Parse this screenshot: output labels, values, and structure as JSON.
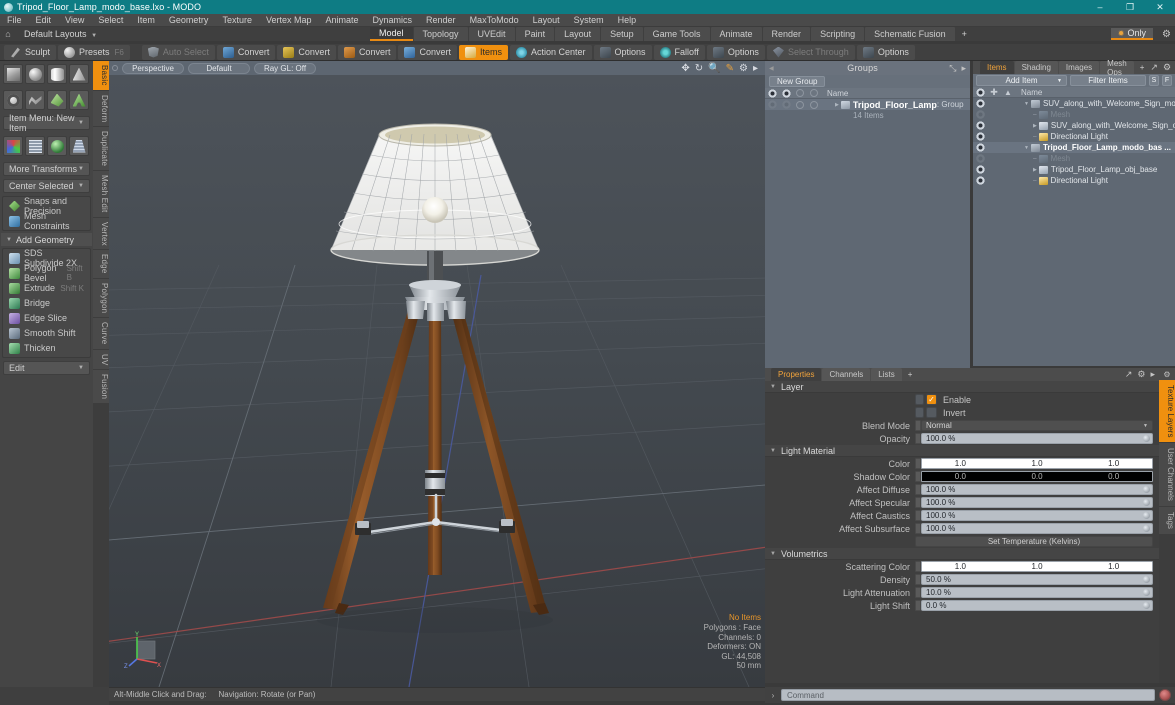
{
  "titlebar": {
    "title": "Tripod_Floor_Lamp_modo_base.lxo - MODO",
    "minimize": "–",
    "maximize": "❐",
    "close": "✕"
  },
  "menubar": {
    "items": [
      "File",
      "Edit",
      "View",
      "Select",
      "Item",
      "Geometry",
      "Texture",
      "Vertex Map",
      "Animate",
      "Dynamics",
      "Render",
      "MaxToModo",
      "Layout",
      "System",
      "Help"
    ]
  },
  "layoutrow": {
    "home_icon": "⌂",
    "layout_label": "Default Layouts",
    "caret": "▼",
    "only_label": "Only",
    "only_star": "✹",
    "gear": "⚙"
  },
  "layout_tabs": {
    "items": [
      "Model",
      "Topology",
      "UVEdit",
      "Paint",
      "Layout",
      "Setup",
      "Game Tools",
      "Animate",
      "Render",
      "Scripting",
      "Schematic Fusion"
    ],
    "active": "Model",
    "plus": "+"
  },
  "toolbar": {
    "buttons": [
      {
        "label": "Sculpt",
        "icon": "sculpt-icon",
        "state": "normal"
      },
      {
        "label": "Presets",
        "icon": "presets-icon",
        "state": "normal",
        "shortcut": "F6"
      },
      {
        "label": "Auto Select",
        "icon": "auto-select-icon",
        "state": "dim"
      },
      {
        "label": "Convert",
        "icon": "convert-blue-icon",
        "state": "normal"
      },
      {
        "label": "Convert",
        "icon": "convert-yellow-icon",
        "state": "normal"
      },
      {
        "label": "Convert",
        "icon": "convert-orange-icon",
        "state": "normal"
      },
      {
        "label": "Convert",
        "icon": "convert-cyan-icon",
        "state": "normal"
      },
      {
        "label": "Items",
        "icon": "items-icon",
        "state": "active"
      },
      {
        "label": "Action Center",
        "icon": "action-center-icon",
        "state": "normal"
      },
      {
        "label": "Options",
        "icon": "options-icon",
        "state": "normal"
      },
      {
        "label": "Falloff",
        "icon": "falloff-icon",
        "state": "normal"
      },
      {
        "label": "Options",
        "icon": "options-icon",
        "state": "normal"
      },
      {
        "label": "Select Through",
        "icon": "select-through-icon",
        "state": "dim"
      },
      {
        "label": "Options",
        "icon": "options-icon",
        "state": "normal"
      }
    ]
  },
  "left_panel": {
    "primitives_row1": [
      "cube-shape-icon",
      "sphere-shape-icon",
      "cylinder-shape-icon",
      "cone-shape-icon"
    ],
    "primitives_row2": [
      "torus-shape-icon",
      "curve-shape-icon",
      "polygon-shape-icon",
      "text-shape-icon"
    ],
    "item_menu": "Item Menu: New Item",
    "tools_row": [
      "transform-axis-icon",
      "grid-mesh-icon",
      "gem-icon",
      "pillar-icon"
    ],
    "more_transforms": "More Transforms",
    "center_selected": "Center Selected",
    "snaps": "Snaps and Precision",
    "mesh_constraints": "Mesh Constraints",
    "add_geometry": "Add Geometry",
    "geometry_tools": [
      {
        "label": "SDS Subdivide 2X",
        "shortcut": ""
      },
      {
        "label": "Polygon Bevel",
        "shortcut": "Shift B"
      },
      {
        "label": "Extrude",
        "shortcut": "Shift K"
      },
      {
        "label": "Bridge",
        "shortcut": ""
      },
      {
        "label": "Edge Slice",
        "shortcut": ""
      },
      {
        "label": "Smooth Shift",
        "shortcut": ""
      },
      {
        "label": "Thicken",
        "shortcut": ""
      }
    ],
    "edit_dropdown": "Edit",
    "vertical_tabs": [
      "Basic",
      "Deform",
      "Duplicate",
      "Mesh Edit",
      "Vertex",
      "Edge",
      "Polygon",
      "Curve",
      "UV",
      "Fusion"
    ],
    "vertical_active": "Basic"
  },
  "viewport": {
    "view_mode": "Perspective",
    "shading": "Default",
    "raygl": "Ray GL: Off",
    "tool_icons": [
      "move-icon",
      "rotate-icon",
      "zoom-icon",
      "paint-icon",
      "gear-icon",
      "arrow-icon"
    ],
    "stats": {
      "selection": "No Items",
      "polygons": "Polygons : Face",
      "channels": "Channels: 0",
      "deformers": "Deformers: ON",
      "gl": "GL: 44,508",
      "scale": "50 mm"
    },
    "axis_labels": {
      "x": "X",
      "y": "Y",
      "z": "Z"
    }
  },
  "statusbar": {
    "hint_key": "Alt-Middle Click and Drag:",
    "hint_text": "Navigation: Rotate (or Pan)"
  },
  "groups_panel": {
    "title": "Groups",
    "expand_icon": "⤡",
    "arrow_icon": "▸",
    "new_group_button": "New Group",
    "column_header": "Name",
    "rows": [
      {
        "name": "Tripod_Floor_Lamp",
        "suffix": ": Group",
        "sub": "14 Items"
      }
    ]
  },
  "items_panel": {
    "tabs": [
      "Items",
      "Shading",
      "Images",
      "Mesh Ops"
    ],
    "active_tab": "Items",
    "plus": "+",
    "add_item": "Add Item",
    "filter_items": "Filter Items",
    "btn_s": "S",
    "btn_f": "F",
    "column_header": "Name",
    "rows": [
      {
        "label": "SUV_along_with_Welcome_Sign_mod...",
        "indent": 1,
        "type": "mesh-group",
        "bold": false,
        "expanded": true,
        "dim": false
      },
      {
        "label": "Mesh",
        "indent": 2,
        "type": "mesh",
        "bold": false,
        "expanded": false,
        "dim": true
      },
      {
        "label": "SUV_along_with_Welcome_Sign_o ...",
        "indent": 2,
        "type": "object",
        "bold": false,
        "expanded": false,
        "dim": false
      },
      {
        "label": "Directional Light",
        "indent": 2,
        "type": "light",
        "bold": false,
        "expanded": false,
        "dim": false
      },
      {
        "label": "Tripod_Floor_Lamp_modo_bas ...",
        "indent": 1,
        "type": "mesh-group",
        "bold": true,
        "expanded": true,
        "dim": false
      },
      {
        "label": "Mesh",
        "indent": 2,
        "type": "mesh",
        "bold": false,
        "expanded": false,
        "dim": true
      },
      {
        "label": "Tripod_Floor_Lamp_obj_base",
        "indent": 2,
        "type": "object",
        "bold": false,
        "expanded": false,
        "dim": false
      },
      {
        "label": "Directional Light",
        "indent": 2,
        "type": "light",
        "bold": false,
        "expanded": false,
        "dim": false
      }
    ]
  },
  "properties_panel": {
    "tabs": [
      "Properties",
      "Channels",
      "Lists"
    ],
    "active_tab": "Properties",
    "plus": "+",
    "sections": [
      {
        "title": "Layer",
        "rows": [
          {
            "kind": "checkbox",
            "label": "Enable",
            "checked": true
          },
          {
            "kind": "checkbox",
            "label": "Invert",
            "checked": false
          },
          {
            "kind": "dropdown",
            "label": "Blend Mode",
            "value": "Normal"
          },
          {
            "kind": "field",
            "label": "Opacity",
            "value": "100.0 %"
          }
        ]
      },
      {
        "title": "Light Material",
        "rows": [
          {
            "kind": "color",
            "label": "Color",
            "swatch": "white",
            "values": [
              "1.0",
              "1.0",
              "1.0"
            ]
          },
          {
            "kind": "color",
            "label": "Shadow Color",
            "swatch": "black",
            "values": [
              "0.0",
              "0.0",
              "0.0"
            ]
          },
          {
            "kind": "field",
            "label": "Affect Diffuse",
            "value": "100.0 %"
          },
          {
            "kind": "field",
            "label": "Affect Specular",
            "value": "100.0 %"
          },
          {
            "kind": "field",
            "label": "Affect Caustics",
            "value": "100.0 %"
          },
          {
            "kind": "field",
            "label": "Affect Subsurface",
            "value": "100.0 %"
          },
          {
            "kind": "button",
            "label": "",
            "value": "Set Temperature (Kelvins)"
          }
        ]
      },
      {
        "title": "Volumetrics",
        "rows": [
          {
            "kind": "color",
            "label": "Scattering Color",
            "swatch": "white",
            "values": [
              "1.0",
              "1.0",
              "1.0"
            ]
          },
          {
            "kind": "field",
            "label": "Density",
            "value": "50.0 %"
          },
          {
            "kind": "field",
            "label": "Light Attenuation",
            "value": "10.0 %"
          },
          {
            "kind": "field",
            "label": "Light Shift",
            "value": "0.0 %"
          }
        ]
      }
    ],
    "vertical_tabs": [
      "Texture Layers",
      "User Channels",
      "Tags"
    ],
    "vertical_active": "Texture Layers"
  },
  "command_bar": {
    "caret": "›",
    "placeholder": "Command",
    "record_icon": "record-icon"
  },
  "colors": {
    "accent": "#f0900f",
    "titlebar": "#0e7c84",
    "panel_blue": "#5f6873",
    "panel_gray": "#454545"
  }
}
